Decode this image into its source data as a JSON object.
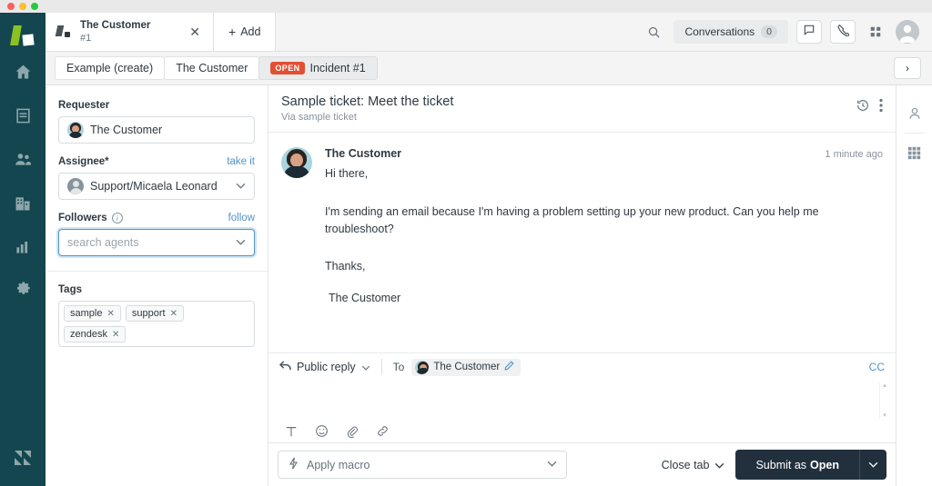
{
  "window": {
    "traffic_lights": [
      "close",
      "minimize",
      "maximize"
    ]
  },
  "nav_rail": {
    "logo": "zendesk-logo",
    "items": [
      {
        "name": "home",
        "icon": "home-icon"
      },
      {
        "name": "views",
        "icon": "views-icon"
      },
      {
        "name": "customers",
        "icon": "customers-icon"
      },
      {
        "name": "organizations",
        "icon": "organizations-icon"
      },
      {
        "name": "reporting",
        "icon": "reporting-icon"
      },
      {
        "name": "admin",
        "icon": "gear-icon"
      }
    ],
    "footer_logo": "zendesk-z-icon"
  },
  "tabstrip": {
    "ticket_tab": {
      "title": "The Customer",
      "subtitle": "#1",
      "close": "✕"
    },
    "add_label": "Add",
    "add_plus": "+",
    "search_icon": "search-icon",
    "conversations_label": "Conversations",
    "conversations_count": "0",
    "chat_icon": "chat-icon",
    "phone_icon": "phone-icon",
    "apps_icon": "apps-grid-icon",
    "avatar": "user-avatar"
  },
  "breadcrumbs": {
    "items": [
      {
        "label": "Example (create)",
        "badge": null,
        "active": false
      },
      {
        "label": "The Customer",
        "badge": null,
        "active": false
      },
      {
        "label": "Incident #1",
        "badge": "OPEN",
        "active": true
      }
    ],
    "next_chevron": "›"
  },
  "properties": {
    "requester": {
      "label": "Requester",
      "value": "The Customer"
    },
    "assignee": {
      "label": "Assignee*",
      "action": "take it",
      "value": "Support/Micaela Leonard"
    },
    "followers": {
      "label": "Followers",
      "info_icon": "info-icon",
      "action": "follow",
      "placeholder": "search agents"
    },
    "tags": {
      "label": "Tags",
      "items": [
        "sample",
        "support",
        "zendesk"
      ],
      "remove_glyph": "✕"
    }
  },
  "ticket": {
    "title": "Sample ticket: Meet the ticket",
    "via": "Via sample ticket",
    "history_icon": "history-clock-icon",
    "more_icon": "more-vertical-icon",
    "message": {
      "author": "The Customer",
      "time": "1 minute ago",
      "greeting": "Hi there,",
      "body": "I'm sending an email because I'm having a problem setting up your new product. Can you help me troubleshoot?",
      "closing": "Thanks,",
      "signature": "The Customer"
    }
  },
  "composer": {
    "reply_type": "Public reply",
    "reply_icon": "reply-arrow-icon",
    "to_label": "To",
    "recipient": "The Customer",
    "edit_icon": "pencil-icon",
    "cc_label": "CC",
    "tools": [
      {
        "name": "text-format-icon",
        "glyph": "T"
      },
      {
        "name": "emoji-icon",
        "glyph": "☺"
      },
      {
        "name": "attachment-icon",
        "glyph": "📎"
      },
      {
        "name": "link-icon",
        "glyph": "🔗"
      }
    ],
    "scroll_up": "▴",
    "scroll_down": "▾"
  },
  "bottom_bar": {
    "macro_placeholder": "Apply macro",
    "macro_icon": "lightning-icon",
    "close_tab_label": "Close tab",
    "submit_prefix": "Submit as",
    "submit_status": "Open"
  },
  "right_rail": {
    "items": [
      {
        "name": "user-panel-icon"
      },
      {
        "name": "apps-panel-icon"
      }
    ]
  },
  "colors": {
    "nav_rail": "#14464f",
    "accent_link": "#5293c7",
    "badge_open": "#e34f32",
    "submit_button": "#22303e",
    "brand_green": "#8bc123"
  }
}
